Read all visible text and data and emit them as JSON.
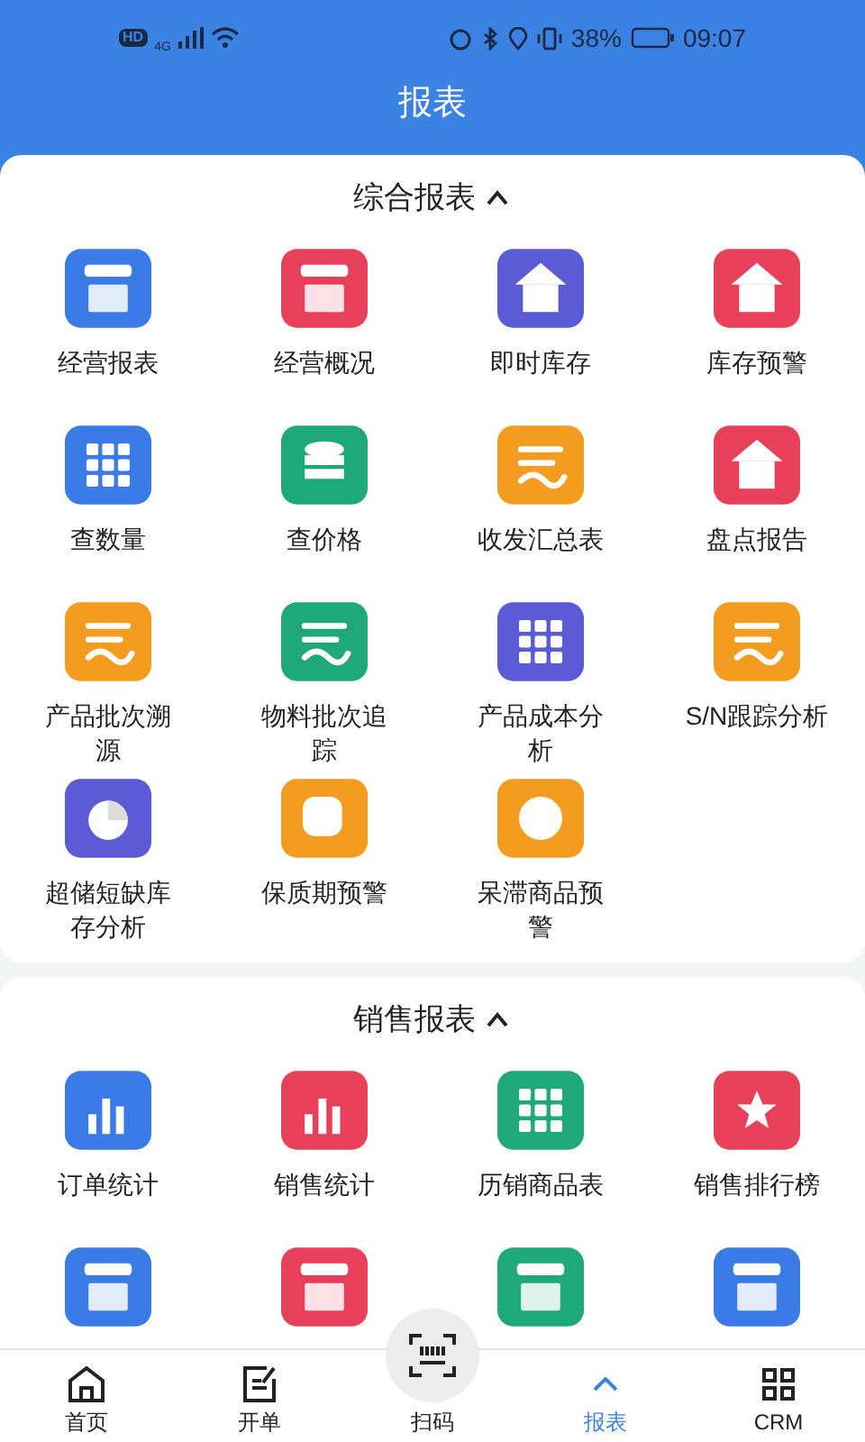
{
  "status_bar": {
    "badge": "HD",
    "network": "4G",
    "battery": "38%",
    "time": "09:07"
  },
  "header": {
    "title": "报表"
  },
  "sections": [
    {
      "title": "综合报表",
      "expanded": true,
      "items": [
        {
          "label": "经营报表",
          "color": "#3b7be8"
        },
        {
          "label": "经营概况",
          "color": "#e8405a"
        },
        {
          "label": "即时库存",
          "color": "#5b5bd6"
        },
        {
          "label": "库存预警",
          "color": "#e8405a"
        },
        {
          "label": "查数量",
          "color": "#3b7be8"
        },
        {
          "label": "查价格",
          "color": "#1fa97a"
        },
        {
          "label": "收发汇总表",
          "color": "#f39c1f"
        },
        {
          "label": "盘点报告",
          "color": "#e8405a"
        },
        {
          "label": "产品批次溯源",
          "color": "#f39c1f"
        },
        {
          "label": "物料批次追踪",
          "color": "#1fa97a"
        },
        {
          "label": "产品成本分析",
          "color": "#5b5bd6"
        },
        {
          "label": "S/N跟踪分析",
          "color": "#f39c1f"
        },
        {
          "label": "超储短缺库存分析",
          "color": "#5b5bd6"
        },
        {
          "label": "保质期预警",
          "color": "#f39c1f"
        },
        {
          "label": "呆滞商品预警",
          "color": "#f39c1f"
        }
      ]
    },
    {
      "title": "销售报表",
      "expanded": true,
      "items": [
        {
          "label": "订单统计",
          "color": "#3b7be8"
        },
        {
          "label": "销售统计",
          "color": "#e8405a"
        },
        {
          "label": "历销商品表",
          "color": "#1fa97a"
        },
        {
          "label": "销售排行榜",
          "color": "#e8405a"
        },
        {
          "color": "#3b7be8"
        },
        {
          "color": "#e8405a"
        },
        {
          "color": "#1fa97a"
        },
        {
          "color": "#3b7be8"
        }
      ]
    }
  ],
  "nav": [
    {
      "label": "首页",
      "kind": "home",
      "selected": false
    },
    {
      "label": "开单",
      "kind": "edit",
      "selected": false
    },
    {
      "label": "扫码",
      "kind": "scan",
      "selected": false
    },
    {
      "label": "报表",
      "kind": "report",
      "selected": true
    },
    {
      "label": "CRM",
      "kind": "crm",
      "selected": false
    }
  ]
}
